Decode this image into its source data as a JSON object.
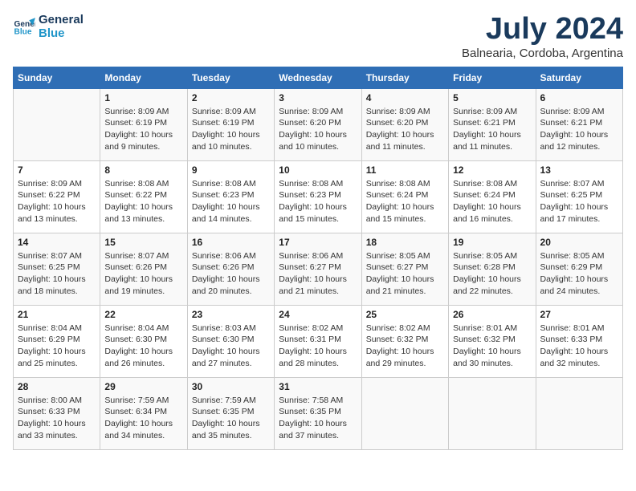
{
  "header": {
    "logo_line1": "General",
    "logo_line2": "Blue",
    "month_year": "July 2024",
    "location": "Balnearia, Cordoba, Argentina"
  },
  "days_of_week": [
    "Sunday",
    "Monday",
    "Tuesday",
    "Wednesday",
    "Thursday",
    "Friday",
    "Saturday"
  ],
  "weeks": [
    [
      {
        "date": "",
        "info": ""
      },
      {
        "date": "1",
        "info": "Sunrise: 8:09 AM\nSunset: 6:19 PM\nDaylight: 10 hours\nand 9 minutes."
      },
      {
        "date": "2",
        "info": "Sunrise: 8:09 AM\nSunset: 6:19 PM\nDaylight: 10 hours\nand 10 minutes."
      },
      {
        "date": "3",
        "info": "Sunrise: 8:09 AM\nSunset: 6:20 PM\nDaylight: 10 hours\nand 10 minutes."
      },
      {
        "date": "4",
        "info": "Sunrise: 8:09 AM\nSunset: 6:20 PM\nDaylight: 10 hours\nand 11 minutes."
      },
      {
        "date": "5",
        "info": "Sunrise: 8:09 AM\nSunset: 6:21 PM\nDaylight: 10 hours\nand 11 minutes."
      },
      {
        "date": "6",
        "info": "Sunrise: 8:09 AM\nSunset: 6:21 PM\nDaylight: 10 hours\nand 12 minutes."
      }
    ],
    [
      {
        "date": "7",
        "info": "Sunrise: 8:09 AM\nSunset: 6:22 PM\nDaylight: 10 hours\nand 13 minutes."
      },
      {
        "date": "8",
        "info": "Sunrise: 8:08 AM\nSunset: 6:22 PM\nDaylight: 10 hours\nand 13 minutes."
      },
      {
        "date": "9",
        "info": "Sunrise: 8:08 AM\nSunset: 6:23 PM\nDaylight: 10 hours\nand 14 minutes."
      },
      {
        "date": "10",
        "info": "Sunrise: 8:08 AM\nSunset: 6:23 PM\nDaylight: 10 hours\nand 15 minutes."
      },
      {
        "date": "11",
        "info": "Sunrise: 8:08 AM\nSunset: 6:24 PM\nDaylight: 10 hours\nand 15 minutes."
      },
      {
        "date": "12",
        "info": "Sunrise: 8:08 AM\nSunset: 6:24 PM\nDaylight: 10 hours\nand 16 minutes."
      },
      {
        "date": "13",
        "info": "Sunrise: 8:07 AM\nSunset: 6:25 PM\nDaylight: 10 hours\nand 17 minutes."
      }
    ],
    [
      {
        "date": "14",
        "info": "Sunrise: 8:07 AM\nSunset: 6:25 PM\nDaylight: 10 hours\nand 18 minutes."
      },
      {
        "date": "15",
        "info": "Sunrise: 8:07 AM\nSunset: 6:26 PM\nDaylight: 10 hours\nand 19 minutes."
      },
      {
        "date": "16",
        "info": "Sunrise: 8:06 AM\nSunset: 6:26 PM\nDaylight: 10 hours\nand 20 minutes."
      },
      {
        "date": "17",
        "info": "Sunrise: 8:06 AM\nSunset: 6:27 PM\nDaylight: 10 hours\nand 21 minutes."
      },
      {
        "date": "18",
        "info": "Sunrise: 8:05 AM\nSunset: 6:27 PM\nDaylight: 10 hours\nand 21 minutes."
      },
      {
        "date": "19",
        "info": "Sunrise: 8:05 AM\nSunset: 6:28 PM\nDaylight: 10 hours\nand 22 minutes."
      },
      {
        "date": "20",
        "info": "Sunrise: 8:05 AM\nSunset: 6:29 PM\nDaylight: 10 hours\nand 24 minutes."
      }
    ],
    [
      {
        "date": "21",
        "info": "Sunrise: 8:04 AM\nSunset: 6:29 PM\nDaylight: 10 hours\nand 25 minutes."
      },
      {
        "date": "22",
        "info": "Sunrise: 8:04 AM\nSunset: 6:30 PM\nDaylight: 10 hours\nand 26 minutes."
      },
      {
        "date": "23",
        "info": "Sunrise: 8:03 AM\nSunset: 6:30 PM\nDaylight: 10 hours\nand 27 minutes."
      },
      {
        "date": "24",
        "info": "Sunrise: 8:02 AM\nSunset: 6:31 PM\nDaylight: 10 hours\nand 28 minutes."
      },
      {
        "date": "25",
        "info": "Sunrise: 8:02 AM\nSunset: 6:32 PM\nDaylight: 10 hours\nand 29 minutes."
      },
      {
        "date": "26",
        "info": "Sunrise: 8:01 AM\nSunset: 6:32 PM\nDaylight: 10 hours\nand 30 minutes."
      },
      {
        "date": "27",
        "info": "Sunrise: 8:01 AM\nSunset: 6:33 PM\nDaylight: 10 hours\nand 32 minutes."
      }
    ],
    [
      {
        "date": "28",
        "info": "Sunrise: 8:00 AM\nSunset: 6:33 PM\nDaylight: 10 hours\nand 33 minutes."
      },
      {
        "date": "29",
        "info": "Sunrise: 7:59 AM\nSunset: 6:34 PM\nDaylight: 10 hours\nand 34 minutes."
      },
      {
        "date": "30",
        "info": "Sunrise: 7:59 AM\nSunset: 6:35 PM\nDaylight: 10 hours\nand 35 minutes."
      },
      {
        "date": "31",
        "info": "Sunrise: 7:58 AM\nSunset: 6:35 PM\nDaylight: 10 hours\nand 37 minutes."
      },
      {
        "date": "",
        "info": ""
      },
      {
        "date": "",
        "info": ""
      },
      {
        "date": "",
        "info": ""
      }
    ]
  ]
}
